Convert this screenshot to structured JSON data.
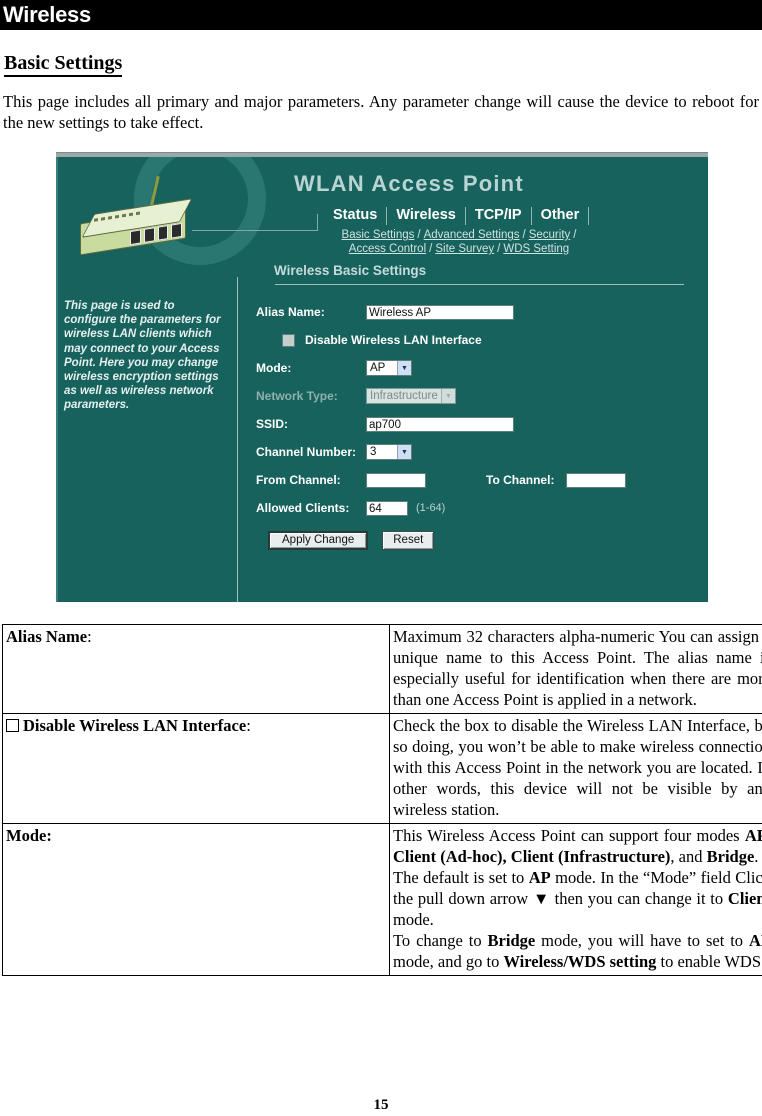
{
  "header": {
    "title": "Wireless"
  },
  "document": {
    "section_title": "Basic Settings",
    "intro": "This page includes all primary and major parameters.  Any parameter change will cause the device to reboot for the new settings to take effect.",
    "page_number": "15"
  },
  "screenshot": {
    "app_title": "WLAN Access Point",
    "tabs": [
      {
        "label": "Status"
      },
      {
        "label": "Wireless"
      },
      {
        "label": "TCP/IP"
      },
      {
        "label": "Other"
      }
    ],
    "sublinks_row1": [
      {
        "label": "Basic Settings"
      },
      {
        "label": "Advanced Settings"
      },
      {
        "label": "Security"
      }
    ],
    "sublinks_row2": [
      {
        "label": "Access Control"
      },
      {
        "label": "Site Survey"
      },
      {
        "label": "WDS Setting"
      }
    ],
    "sublink_separator": "/",
    "section_heading": "Wireless Basic Settings",
    "description": "This page is used to configure the parameters for wireless LAN clients which may connect to your Access Point. Here you may change wireless encryption settings as well as wireless network parameters.",
    "form": {
      "alias_name_label": "Alias Name:",
      "alias_name_value": "Wireless AP",
      "disable_wlan_label": "Disable Wireless LAN Interface",
      "mode_label": "Mode:",
      "mode_value": "AP",
      "network_type_label": "Network Type:",
      "network_type_value": "Infrastructure",
      "ssid_label": "SSID:",
      "ssid_value": "ap700",
      "channel_number_label": "Channel Number:",
      "channel_number_value": "3",
      "from_channel_label": "From Channel:",
      "from_channel_value": "",
      "to_channel_label": "To Channel:",
      "to_channel_value": "",
      "allowed_clients_label": "Allowed Clients:",
      "allowed_clients_value": "64",
      "allowed_clients_hint": "(1-64)",
      "apply_button": "Apply Change",
      "reset_button": "Reset"
    },
    "colors": {
      "background": "#17625c",
      "title_text": "#b9d4d2",
      "label_text": "#ffffff"
    }
  },
  "table": {
    "rows": [
      {
        "term": "Alias Name",
        "term_suffix": ":",
        "has_checkbox": false,
        "definition": "Maximum 32 characters alpha-numeric You can assign a unique name to this Access Point. The alias name is especially useful for identification when there are more than one Access Point is applied in a network."
      },
      {
        "term": "Disable Wireless LAN Interface",
        "term_suffix": ":",
        "has_checkbox": true,
        "definition": "Check the box to disable the Wireless LAN Interface, by so doing, you won’t be able to make wireless connection with this Access Point in the network you are located. In other words, this device will not be visible by any wireless station."
      },
      {
        "term": "Mode:",
        "term_suffix": "",
        "has_checkbox": false,
        "definition_parts": [
          {
            "text": "This Wireless Access Point can support four modes ",
            "bold": false
          },
          {
            "text": "AP",
            "bold": true
          },
          {
            "text": ", ",
            "bold": false
          },
          {
            "text": "Client (Ad-hoc), Client (Infrastructure)",
            "bold": true
          },
          {
            "text": ", and ",
            "bold": false
          },
          {
            "text": "Bridge",
            "bold": true
          },
          {
            "text": ".",
            "bold": false
          }
        ],
        "paragraph2": [
          {
            "text": "The default is set to ",
            "bold": false
          },
          {
            "text": "AP",
            "bold": true
          },
          {
            "text": " mode. In the “Mode” field Click the pull down arrow ▼ then you can change it to ",
            "bold": false
          },
          {
            "text": "Client",
            "bold": true
          },
          {
            "text": " mode.",
            "bold": false
          }
        ],
        "paragraph3": [
          {
            "text": "To change to ",
            "bold": false
          },
          {
            "text": "Bridge",
            "bold": true
          },
          {
            "text": " mode, you will have to set to ",
            "bold": false
          },
          {
            "text": "AP",
            "bold": true
          },
          {
            "text": " mode, and go to ",
            "bold": false
          },
          {
            "text": "Wireless/WDS setting",
            "bold": true
          },
          {
            "text": " to enable WDS.",
            "bold": false
          }
        ]
      }
    ]
  }
}
